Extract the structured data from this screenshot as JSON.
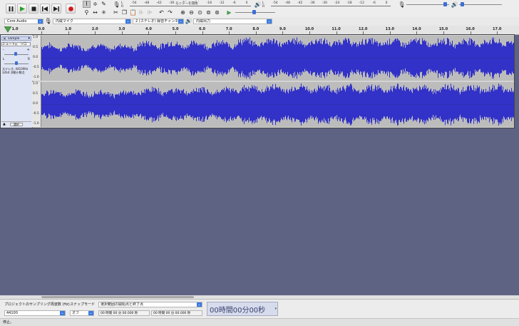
{
  "colors": {
    "waveform": "#3232c8",
    "canvas": "#5f6383",
    "track_bg": "#bcbcbc",
    "toolbar": "#ededed",
    "record": "#d01818",
    "play": "#2a9d2a",
    "accent": "#3b7ae0"
  },
  "transport": {
    "pause": "pause-icon",
    "play": "play-icon",
    "stop": "stop-icon",
    "skip_start": "skip-start-icon",
    "skip_end": "skip-end-icon",
    "record": "record-icon"
  },
  "meters": {
    "record_ticks": [
      "-54",
      "-48",
      "-42",
      "-36",
      "-30",
      "-24",
      "-18",
      "-12",
      "-6",
      "0"
    ],
    "record_label": "モニターを開始",
    "playback_ticks": [
      "-54",
      "-48",
      "-42",
      "-36",
      "-30",
      "-24",
      "-18",
      "-12",
      "-6",
      "0"
    ],
    "channel_labels": [
      "L",
      "R"
    ]
  },
  "devices": {
    "host": "Core Audio",
    "input": "内蔵マイク",
    "channels": "2 (ステレオ) 録音チャンネル",
    "output": "内蔵出力"
  },
  "ruler": {
    "ticks": [
      "1.0",
      "0.0",
      "1.0",
      "2.0",
      "3.0",
      "4.0",
      "5.0",
      "6.0",
      "7.0",
      "8.0",
      "9.0",
      "10.0",
      "11.0",
      "12.0",
      "13.0",
      "14.0",
      "15.0",
      "16.0",
      "17.0"
    ]
  },
  "track": {
    "name": "sample",
    "mute": "ミュート",
    "solo": "ソロ",
    "gain_left": "-",
    "gain_right": "+",
    "pan_left": "L",
    "pan_right": "R",
    "info_line1": "ステレオ, 44100Hz",
    "info_line2": "32bit 浮動小数点",
    "select": "選択",
    "scale": [
      "1.0",
      "0.5",
      "0.0",
      "-0.5",
      "-1.0"
    ]
  },
  "selection_toolbar": {
    "rate_label": "プロジェクトのサンプリング周波数 (Hz)",
    "rate_value": "44100",
    "snap_label": "スナップモード",
    "snap_value": "オフ",
    "range_mode": "選択範囲の開始点と終了点",
    "start_time": "00 時間 00 分 00.000 秒",
    "end_time": "00 時間 00 分 00.000 秒",
    "big_time": "00時間00分00秒"
  },
  "status": {
    "text": "停止。"
  }
}
